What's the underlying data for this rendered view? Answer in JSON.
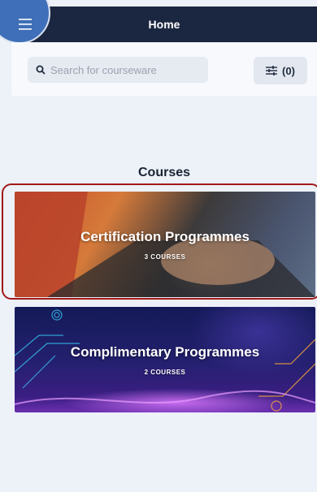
{
  "header": {
    "title": "Home",
    "menu_icon": "hamburger-menu-icon"
  },
  "search": {
    "placeholder": "Search for courseware",
    "value": "",
    "icon": "search-icon"
  },
  "filter": {
    "icon": "filter-sliders-icon",
    "label": "(0)"
  },
  "courses": {
    "heading": "Courses",
    "cards": [
      {
        "title": "Certification Programmes",
        "subtitle": "3 COURSES"
      },
      {
        "title": "Complimentary Programmes",
        "subtitle": "2 COURSES"
      }
    ]
  },
  "colors": {
    "header_bg": "#1b2740",
    "highlight": "#a21818",
    "background": "#edf1f8"
  }
}
